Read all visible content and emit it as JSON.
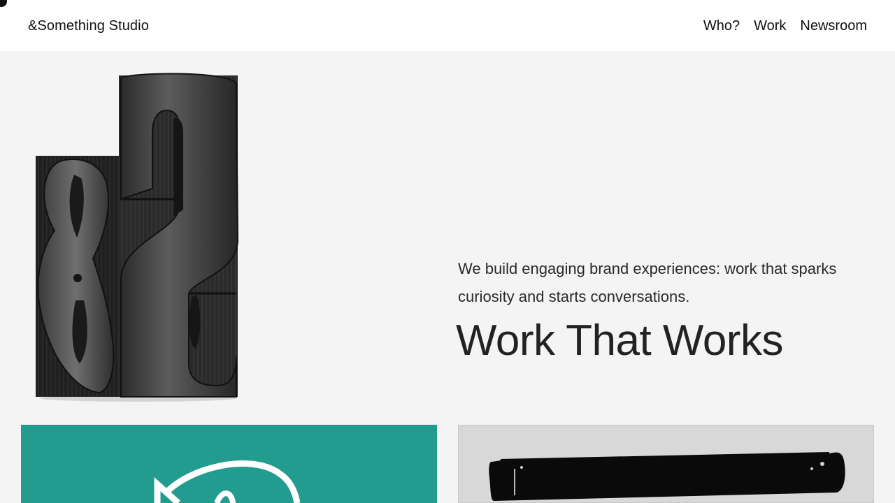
{
  "header": {
    "brand": "&Something Studio",
    "nav": [
      {
        "label": "Who?"
      },
      {
        "label": "Work"
      },
      {
        "label": "Newsroom"
      }
    ]
  },
  "hero": {
    "tagline": "We build engaging brand experiences: work that sparks curiosity and starts conversations.",
    "headline": "Work That Works",
    "image_icon": "wooden-type-ampersand-and-s"
  },
  "work_grid": {
    "cards": [
      {
        "name": "teal-project-card",
        "background": "#219c8e"
      },
      {
        "name": "ink-brushstroke-card",
        "background": "#d8d8d8"
      }
    ]
  },
  "colors": {
    "page_background": "#f4f4f4",
    "header_background": "#ffffff",
    "text": "#222222",
    "teal": "#219c8e"
  }
}
